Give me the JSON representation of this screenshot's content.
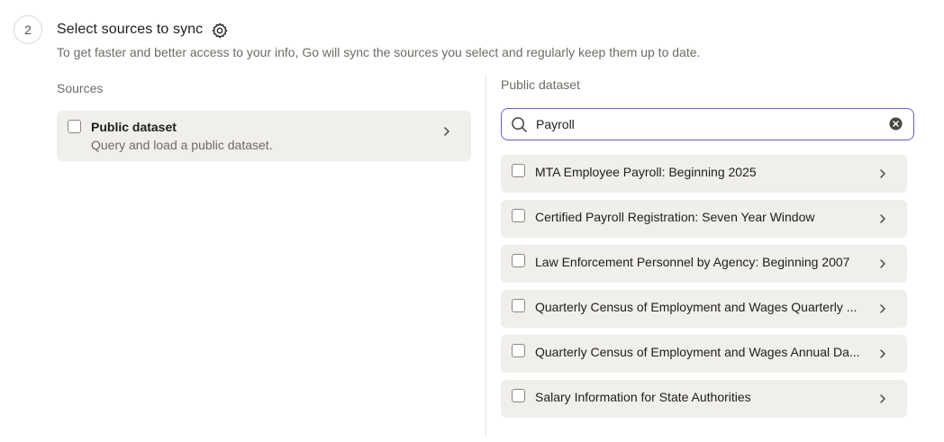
{
  "step": {
    "number": "2",
    "title": "Select sources to sync",
    "description": "To get faster and better access to your info, Go will sync the sources you select and regularly keep them up to date."
  },
  "sources": {
    "label": "Sources",
    "items": [
      {
        "title": "Public dataset",
        "subtitle": "Query and load a public dataset.",
        "checked": false
      }
    ]
  },
  "dataset_panel": {
    "label": "Public dataset",
    "search": {
      "value": "Payroll",
      "icon": "search-icon",
      "clear_icon": "clear-icon"
    },
    "results": [
      {
        "label": "MTA Employee Payroll: Beginning 2025",
        "checked": false
      },
      {
        "label": "Certified Payroll Registration: Seven Year Window",
        "checked": false
      },
      {
        "label": "Law Enforcement Personnel by Agency: Beginning 2007",
        "checked": false
      },
      {
        "label": "Quarterly Census of Employment and Wages Quarterly ...",
        "checked": false
      },
      {
        "label": "Quarterly Census of Employment and Wages Annual Da...",
        "checked": false
      },
      {
        "label": "Salary Information for State Authorities",
        "checked": false
      }
    ]
  },
  "colors": {
    "accent": "#6f5bbf",
    "card_bg": "#f1efeb",
    "muted_text": "#6e6b65"
  }
}
